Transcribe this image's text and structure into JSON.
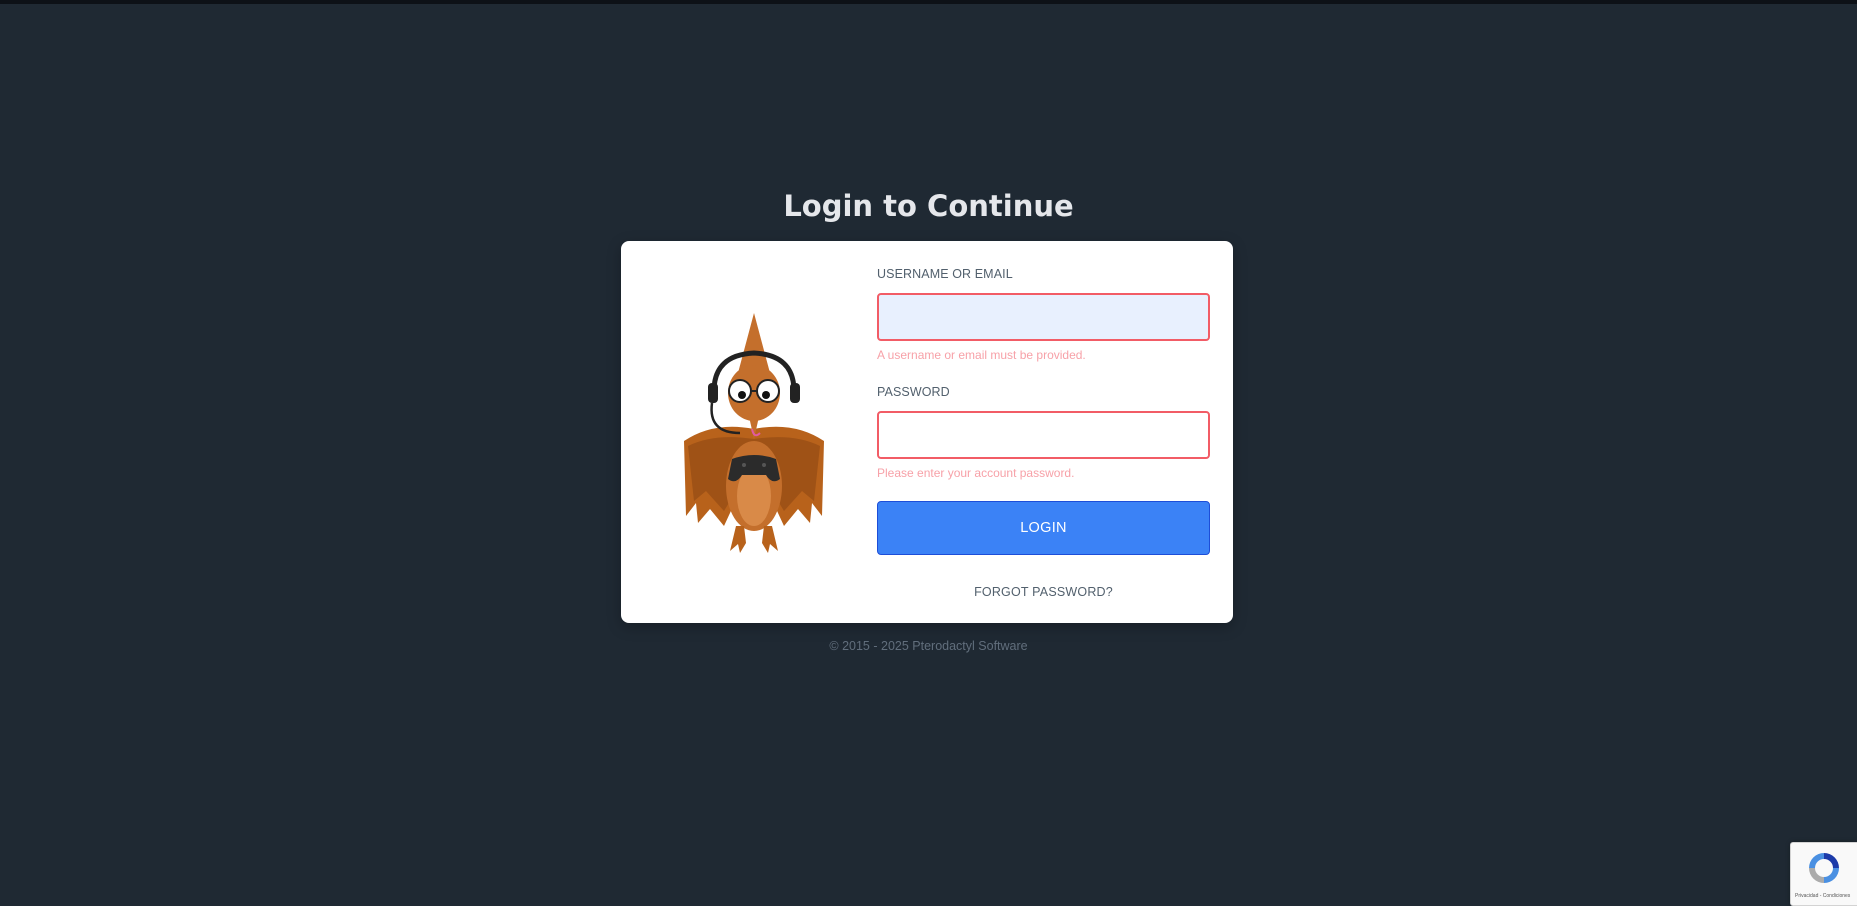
{
  "page": {
    "title": "Login to Continue",
    "footer": "© 2015 - 2025 Pterodactyl Software"
  },
  "form": {
    "username": {
      "label": "USERNAME OR EMAIL",
      "value": "",
      "error": "A username or email must be provided."
    },
    "password": {
      "label": "PASSWORD",
      "value": "",
      "error": "Please enter your account password."
    },
    "login_button": "LOGIN",
    "forgot_link": "FORGOT PASSWORD?"
  },
  "recaptcha": {
    "text": "Privacidad - Condiciones"
  },
  "colors": {
    "background": "#1f2933",
    "accent": "#3b82f6",
    "error_border": "#f25c66",
    "error_text": "#f7a1a8"
  },
  "icons": {
    "mascot": "pterodactyl-mascot-icon",
    "recaptcha": "recaptcha-icon"
  }
}
